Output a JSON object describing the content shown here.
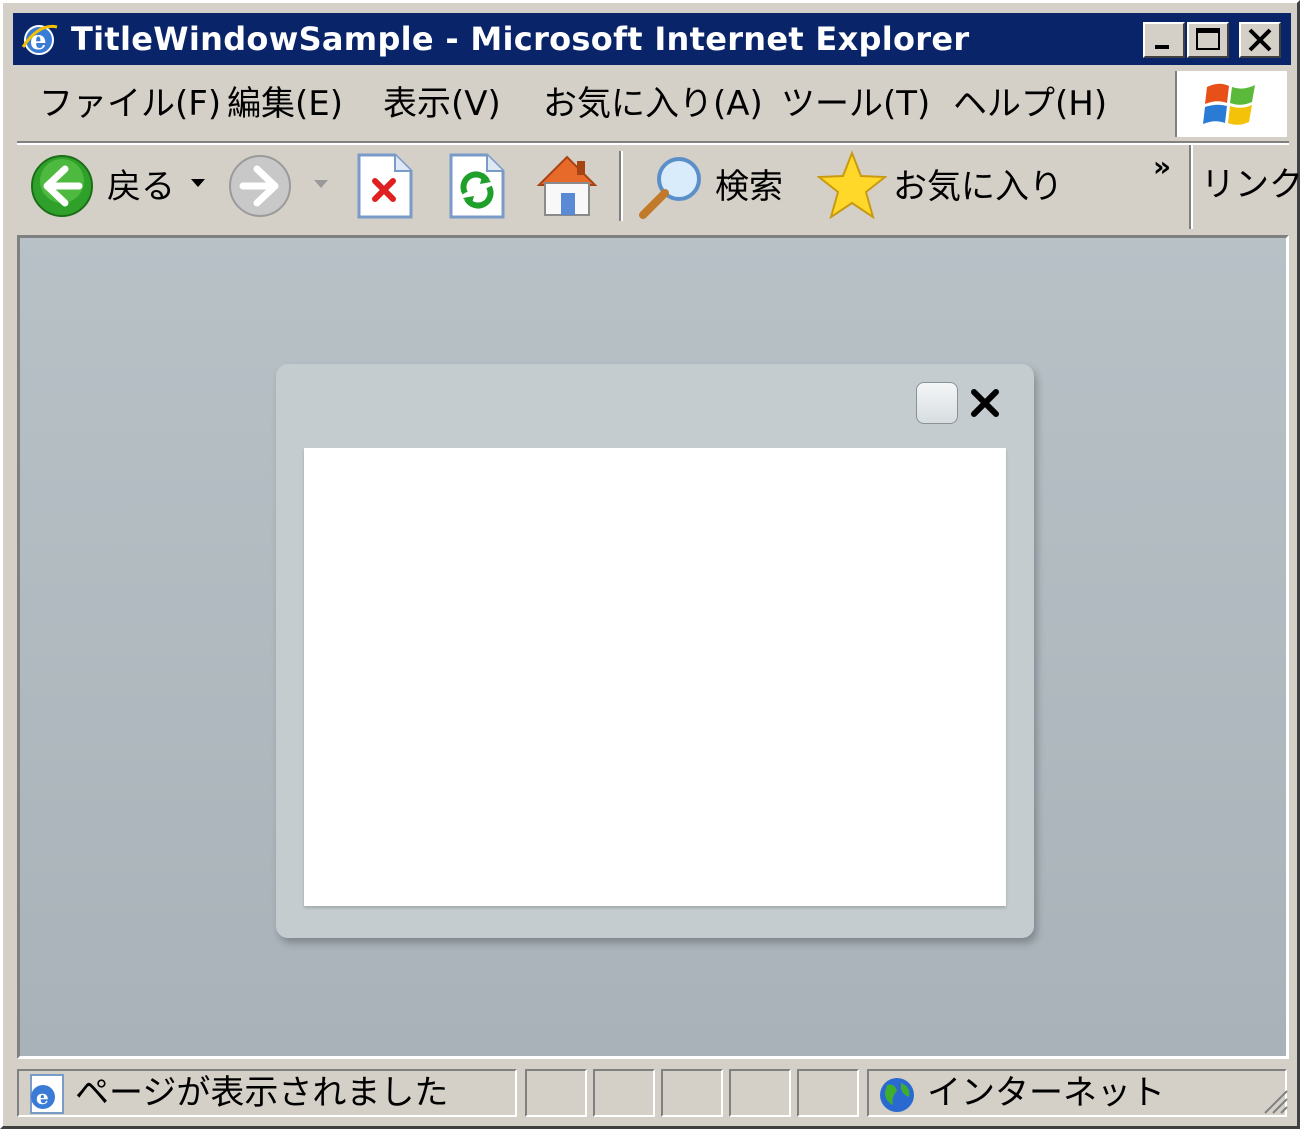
{
  "window": {
    "title": "TitleWindowSample - Microsoft Internet Explorer",
    "controls": {
      "minimize_icon": "minimize-icon",
      "maximize_icon": "maximize-icon",
      "close_icon": "close-icon"
    }
  },
  "menu": {
    "items": [
      {
        "label": "ファイル(F)"
      },
      {
        "label": "編集(E)"
      },
      {
        "label": "表示(V)"
      },
      {
        "label": "お気に入り(A)"
      },
      {
        "label": "ツール(T)"
      },
      {
        "label": "ヘルプ(H)"
      }
    ]
  },
  "toolbar": {
    "back_label": "戻る",
    "search_label": "検索",
    "favorites_label": "お気に入り",
    "chevron": "»",
    "links_label": "リンク"
  },
  "panel": {
    "minimize_icon": "panel-minimize-icon",
    "close_icon": "panel-close-icon"
  },
  "status": {
    "message": "ページが表示されました",
    "zone": "インターネット"
  },
  "colors": {
    "titlebar": "#0a246a",
    "chrome": "#d4d0c8",
    "content_bg": "#b7c1c6",
    "panel_bg": "#c4ccd0"
  }
}
